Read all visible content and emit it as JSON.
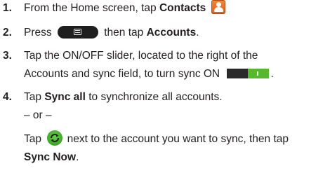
{
  "steps": [
    {
      "number": "1.",
      "before": "From the Home screen, tap ",
      "bold": "Contacts",
      "icon": "contacts-icon"
    },
    {
      "number": "2.",
      "before": "Press",
      "icon": "menu-key-icon",
      "middle": "then tap ",
      "bold": "Accounts",
      "after": "."
    },
    {
      "number": "3.",
      "line1": "Tap the ON/OFF slider, located to the right of the",
      "line2": "Accounts and sync field, to turn sync ON",
      "icon": "toggle-on-icon",
      "after": "."
    },
    {
      "number": "4.",
      "before": "Tap ",
      "bold": "Sync all",
      "after": " to synchronize all accounts.",
      "or_line": "– or –",
      "alt_before": "Tap",
      "alt_icon": "sync-icon",
      "alt_after": "next to the account you want to sync, then tap",
      "alt_bold": "Sync Now",
      "alt_end": "."
    }
  ],
  "colors": {
    "text": "#231f20",
    "contacts_icon": "#e8762c",
    "toggle_on": "#55b82f",
    "sync_icon": "#3aa82a"
  }
}
